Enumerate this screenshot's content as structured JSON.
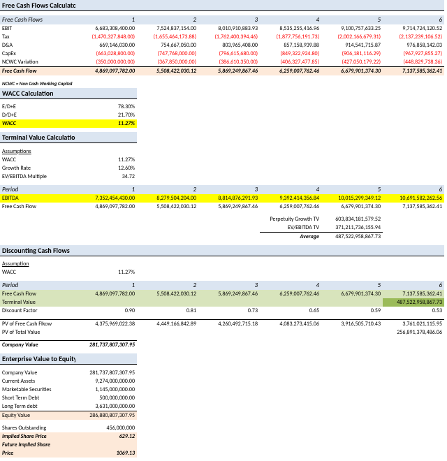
{
  "sections": {
    "fcf": "Free Cash Flows Calculator",
    "fcf_sub": "Free Cash Flows",
    "wacc": "WACC Calculation",
    "tv": "Terminal Value Calculation",
    "dcf": "Discounting Cash Flows",
    "ev": "Enterprise Value to Equity Value"
  },
  "periods": [
    "1",
    "2",
    "3",
    "4",
    "5",
    "6"
  ],
  "fcf_rows": {
    "EBIT": [
      "6,683,308,400.00",
      "7,524,837,154.00",
      "8,010,910,883.93",
      "8,535,255,416.96",
      "9,100,757,633.25",
      "9,714,724,120.52"
    ],
    "Tax": [
      "(1,470,327,848.00)",
      "(1,655,464,173.88)",
      "(1,762,400,394.46)",
      "(1,877,756,191.73)",
      "(2,002,166,679.31)",
      "(2,137,239,106.52)"
    ],
    "D&A": [
      "669,146,030.00",
      "754,667,050.00",
      "803,965,408.00",
      "857,158,939.88",
      "914,541,715.87",
      "976,858,142.03"
    ],
    "CapEx": [
      "(663,028,800.00)",
      "(747,768,000.00)",
      "(796,615,680.00)",
      "(849,322,924.80)",
      "(906,181,116.29)",
      "(967,927,855.27)"
    ],
    "NCWC Variation": [
      "(350,000,000.00)",
      "(367,850,000.00)",
      "(386,610,350.00)",
      "(406,327,477.85)",
      "(427,050,179.22)",
      "(448,829,738.36)"
    ]
  },
  "fcf_total_label": "Free Cash Flow",
  "fcf_total": [
    "4,869,097,782.00",
    "5,508,422,030.12",
    "5,869,249,867.46",
    "6,259,007,762.46",
    "6,679,901,374.30",
    "7,137,585,362.41"
  ],
  "ncwc_note": "NCWC = Non Cash Working Capital",
  "wacc_rows": {
    "E/D+E": "78.30%",
    "D/D+E": "21.70%"
  },
  "wacc_label": "WACC",
  "wacc_val": "11.27%",
  "assumptions_label": "Assumptions",
  "tv_assumptions": {
    "WACC": "11.27%",
    "Growth Rate": "12.60%",
    "EV/EBITDA Multiple": "34.72"
  },
  "period_label": "Period",
  "ebitda_label": "EBITDA",
  "ebitda": [
    "7,352,454,430.00",
    "8,279,504,204.00",
    "8,814,876,291.93",
    "9,392,414,356.84",
    "10,015,299,349.12",
    "10,691,582,262.56"
  ],
  "fcf2_label": "Free Cash Flow",
  "fcf2": [
    "4,869,097,782.00",
    "5,508,422,030.12",
    "5,869,249,867.46",
    "6,259,007,762.46",
    "6,679,901,374.30",
    "7,137,585,362.41"
  ],
  "tv_lines": {
    "Perpetuity Growth TV": "603,834,181,579.52",
    "EV/EBITDA TV": "371,211,736,155.94"
  },
  "avg_label": "Average",
  "avg_val": "487,522,958,867.73",
  "dcf_assumption_label": "Assumption",
  "dcf_wacc": "11.27%",
  "dcf_period": [
    "1",
    "2",
    "3",
    "4",
    "5",
    "6"
  ],
  "dcf_fcf_label": "Free Cash Flow",
  "dcf_fcf": [
    "4,869,097,782.00",
    "5,508,422,030.12",
    "5,869,249,867.46",
    "6,259,007,762.46",
    "6,679,901,374.30",
    "7,137,585,362.41"
  ],
  "term_val_label": "Terminal Value",
  "term_val": "487,522,958,867.73",
  "disc_label": "Discount Factor",
  "disc": [
    "0.90",
    "0.81",
    "0.73",
    "0.65",
    "0.59",
    "0.53"
  ],
  "pvfcf_label": "PV of Free Cash Flkow",
  "pvfcf": [
    "4,375,969,022.38",
    "4,449,166,842.89",
    "4,260,492,715.18",
    "4,083,273,415.06",
    "3,916,505,710.43",
    "3,761,021,115.95"
  ],
  "pvtv_label": "PV of Total Value",
  "pvtv": "256,891,378,486.06",
  "company_val_label": "Company Value",
  "company_val": "281,737,807,307.95",
  "ev_rows": {
    "Company Value": "281,737,807,307.95",
    "Current Assets": "9,274,000,000.00",
    "Marketable Securities": "1,145,000,000.00",
    "Short Term Debt": "500,000,000.00",
    "Long Term debt": "3,631,000,000.00"
  },
  "equity_label": "Equity Value",
  "equity_val": "286,880,807,307.95",
  "shares_label": "Shares Outstanding",
  "shares_val": "456,000,000",
  "imp_label": "Implied Share Price",
  "imp_val": "629.12",
  "fut_label": "Future Implied Share",
  "price_label": "Price",
  "fut_val": "1069.13"
}
